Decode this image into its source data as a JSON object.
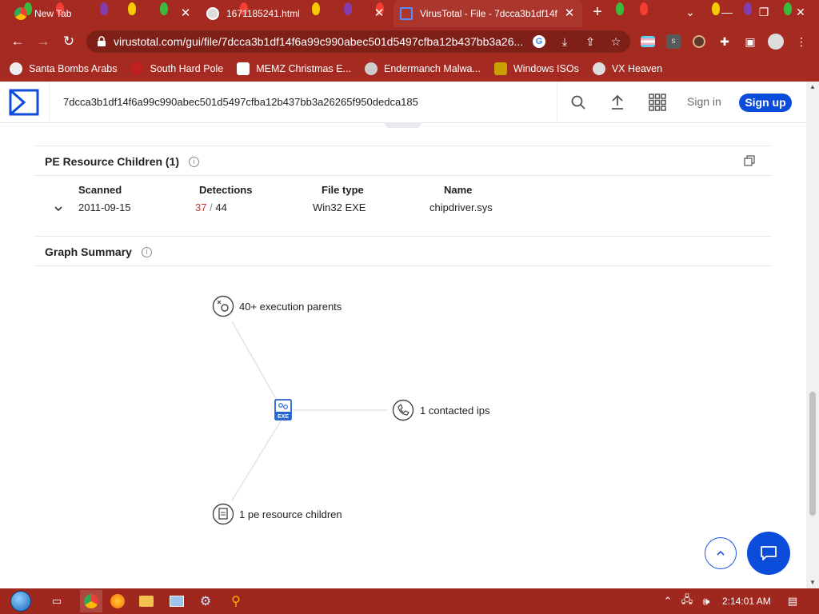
{
  "browser": {
    "tabs": [
      {
        "title": "New Tab",
        "active": false
      },
      {
        "title": "1671185241.html",
        "active": false
      },
      {
        "title": "VirusTotal - File - 7dcca3b1df14f",
        "active": true
      }
    ],
    "url": "virustotal.com/gui/file/7dcca3b1df14f6a99c990abec501d5497cfba12b437bb3a26...",
    "bookmarks": [
      "Santa Bombs Arabs",
      "South Hard Pole",
      "MEMZ Christmas E...",
      "Endermanch Malwa...",
      "Windows ISOs",
      "VX Heaven"
    ],
    "theme_color": "#a52a21"
  },
  "header": {
    "search_value": "7dcca3b1df14f6a99c990abec501d5497cfba12b437bb3a26265f950dedca185",
    "sign_in": "Sign in",
    "sign_up": "Sign up",
    "accent": "#0b4dda"
  },
  "pe_resources": {
    "title": "PE Resource Children (1)",
    "columns": [
      "Scanned",
      "Detections",
      "File type",
      "Name"
    ],
    "rows": [
      {
        "scanned": "2011-09-15",
        "detections_hit": "37",
        "detections_sep": "/",
        "detections_total": "44",
        "file_type": "Win32 EXE",
        "name": "chipdriver.sys"
      }
    ]
  },
  "graph_summary": {
    "title": "Graph Summary",
    "center_label": "EXE",
    "nodes": [
      {
        "label": "40+ execution parents",
        "icon": "execution-parents-icon"
      },
      {
        "label": "1 contacted ips",
        "icon": "contacted-ips-icon"
      },
      {
        "label": "1 pe resource children",
        "icon": "pe-resource-icon"
      }
    ]
  },
  "taskbar": {
    "clock": "2:14:01 AM"
  }
}
